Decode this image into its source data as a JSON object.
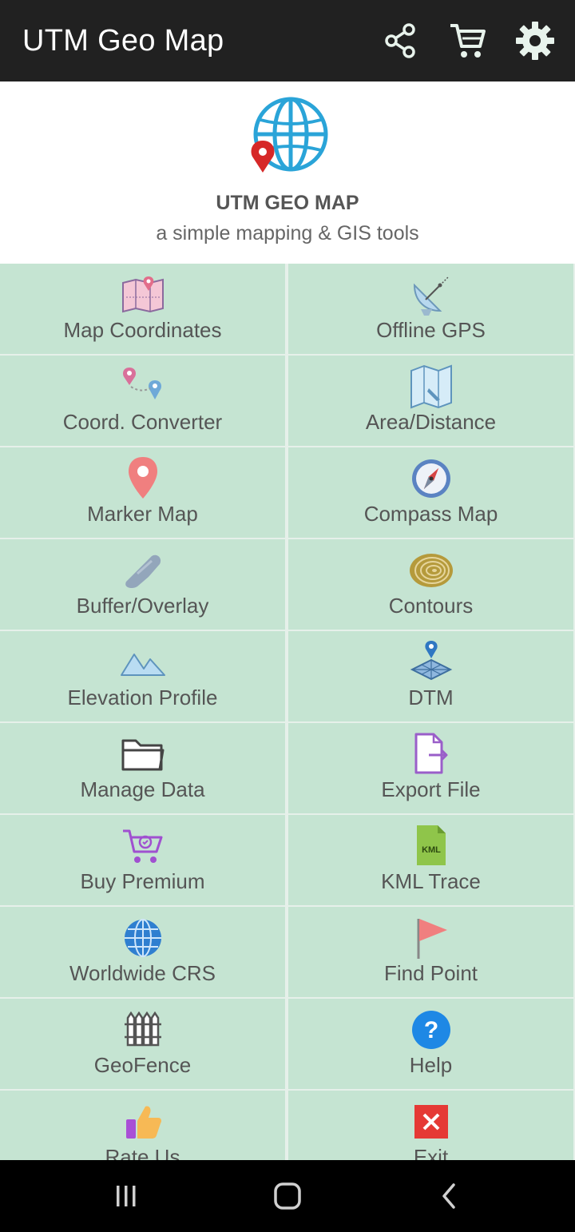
{
  "app_bar": {
    "title": "UTM Geo Map",
    "actions": [
      "share-icon",
      "cart-icon",
      "settings-icon"
    ]
  },
  "header": {
    "title": "UTM GEO MAP",
    "subtitle": "a simple mapping & GIS tools"
  },
  "menu": [
    {
      "label": "Map Coordinates",
      "icon": "map-pin-icon"
    },
    {
      "label": "Offline GPS",
      "icon": "satellite-dish-icon"
    },
    {
      "label": "Coord. Converter",
      "icon": "route-pins-icon"
    },
    {
      "label": "Area/Distance",
      "icon": "folded-map-icon"
    },
    {
      "label": "Marker Map",
      "icon": "marker-icon"
    },
    {
      "label": "Compass Map",
      "icon": "compass-icon"
    },
    {
      "label": "Buffer/Overlay",
      "icon": "buffer-icon"
    },
    {
      "label": "Contours",
      "icon": "contours-icon"
    },
    {
      "label": "Elevation Profile",
      "icon": "mountains-icon"
    },
    {
      "label": "DTM",
      "icon": "dtm-icon"
    },
    {
      "label": "Manage Data",
      "icon": "folder-icon"
    },
    {
      "label": "Export File",
      "icon": "export-file-icon"
    },
    {
      "label": "Buy Premium",
      "icon": "shopping-cart-icon"
    },
    {
      "label": "KML Trace",
      "icon": "kml-file-icon"
    },
    {
      "label": "Worldwide CRS",
      "icon": "globe-icon"
    },
    {
      "label": "Find Point",
      "icon": "flag-icon"
    },
    {
      "label": "GeoFence",
      "icon": "fence-icon"
    },
    {
      "label": "Help",
      "icon": "help-icon"
    },
    {
      "label": "Rate Us",
      "icon": "thumbs-up-icon"
    },
    {
      "label": "Exit",
      "icon": "exit-icon"
    }
  ],
  "kml_badge": "KML",
  "nav_bar": [
    "recents-icon",
    "home-icon",
    "back-icon"
  ],
  "colors": {
    "app_bar": "#212121",
    "tile": "#c5e4d2",
    "tile_gap": "#e6f0ea",
    "label": "#555555",
    "nav_bar": "#000000"
  }
}
